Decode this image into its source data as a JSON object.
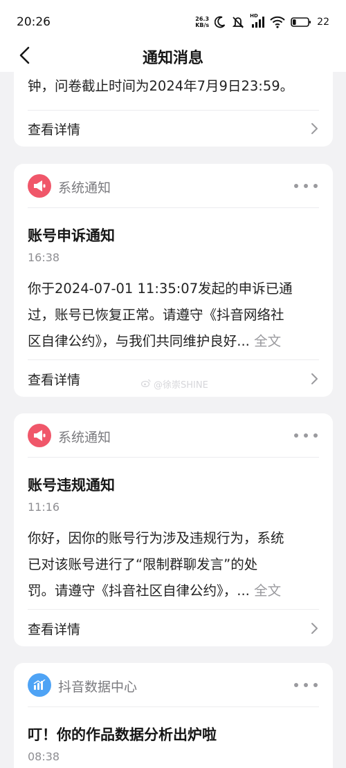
{
  "status_bar": {
    "time": "20:26",
    "net_speed_value": "26.3",
    "net_speed_unit": "KB/s",
    "hd_label": "HD",
    "battery_percent": "22",
    "battery_level": 0.22
  },
  "nav": {
    "title": "通知消息"
  },
  "card0": {
    "body_tail": "钟，问卷截止时间为2024年7月9日23:59。",
    "detail_label": "查看详情"
  },
  "card1": {
    "category": "系统通知",
    "title": "账号申诉通知",
    "time": "16:38",
    "body_lines": [
      "你于2024-07-01 11:35:07发起的申诉已通",
      "过，账号已恢复正常。请遵守《抖音网络社",
      "区自律公约》，与我们共同维护良好..."
    ],
    "read_more": "全文",
    "detail_label": "查看详情"
  },
  "card2": {
    "category": "系统通知",
    "title": "账号违规通知",
    "time": "11:16",
    "body_lines": [
      "你好，因你的账号行为涉及违规行为，系统",
      "已对该账号进行了“限制群聊发言”的处",
      "罚。请遵守《抖音社区自律公约》，..."
    ],
    "read_more": "全文",
    "detail_label": "查看详情"
  },
  "card3": {
    "category": "抖音数据中心",
    "title": "叮！你的作品数据分析出炉啦",
    "time": "08:38"
  },
  "watermark": {
    "text": "@徐崇SHINE"
  },
  "colors": {
    "background": "#f2f2f4",
    "system_icon": "#f0576a",
    "data_center_icon": "#4ea3f5"
  },
  "icons": {
    "back": "chevron-left-icon",
    "system": "megaphone-icon",
    "data_center": "bar-chart-icon",
    "more": "more-dots-icon",
    "detail": "chevron-right-icon"
  }
}
